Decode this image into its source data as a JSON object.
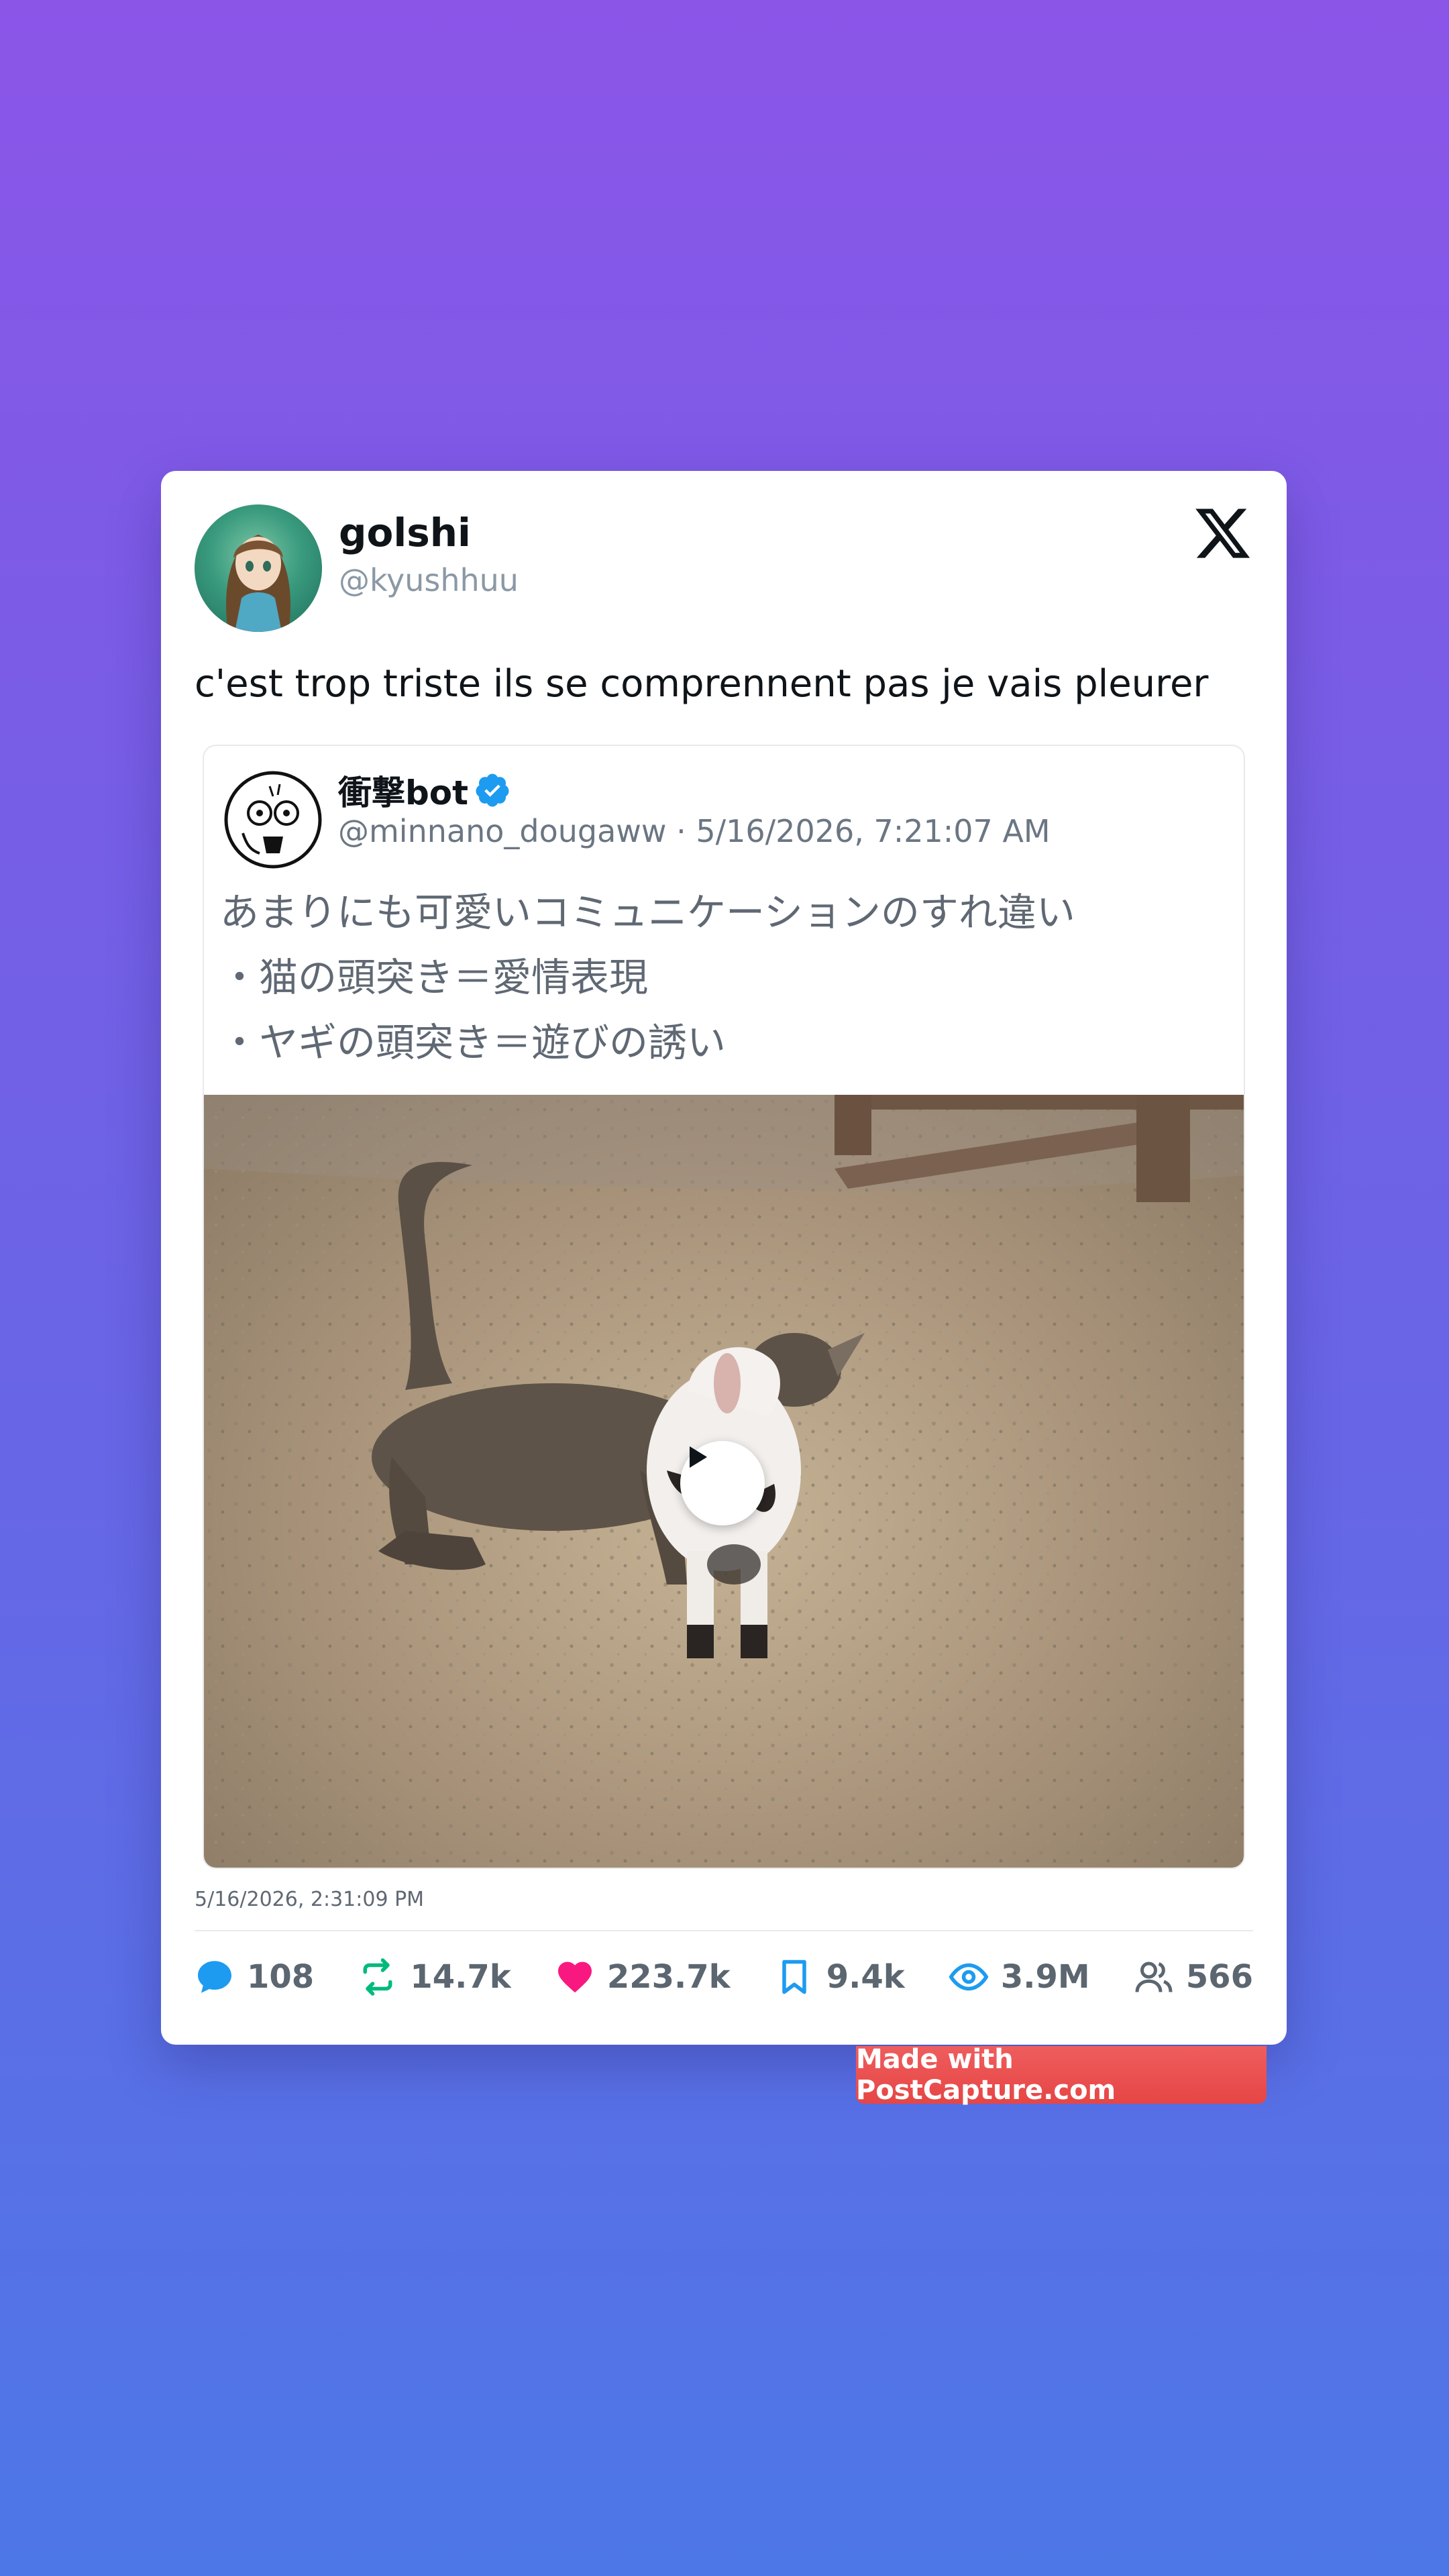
{
  "tweet": {
    "display_name": "golshi",
    "handle": "@kyushhuu",
    "text": "c'est trop triste ils se comprennent pas je vais pleurer",
    "timestamp": "5/16/2026, 2:31:09 PM"
  },
  "quoted": {
    "name": "衝撃bot",
    "meta": "@minnano_dougaww · 5/16/2026, 7:21:07 AM",
    "lines": [
      "あまりにも可愛いコミュニケーションのすれ違い",
      "・猫の頭突き＝愛情表現",
      "・ヤギの頭突き＝遊びの誘い"
    ]
  },
  "stats": {
    "replies": "108",
    "retweets": "14.7k",
    "likes": "223.7k",
    "bookmarks": "9.4k",
    "views": "3.9M",
    "followers": "566"
  },
  "badge": "Made with PostCapture.com",
  "colors": {
    "reply": "#1d9bf0",
    "retweet": "#00ba7c",
    "like": "#f91880",
    "bookmark": "#1d9bf0",
    "views": "#1d9bf0",
    "followers": "#5b6670"
  },
  "icons": [
    "x-logo-icon",
    "verified-badge-icon",
    "play-icon",
    "reply-icon",
    "retweet-icon",
    "like-icon",
    "bookmark-icon",
    "views-icon",
    "followers-icon"
  ]
}
